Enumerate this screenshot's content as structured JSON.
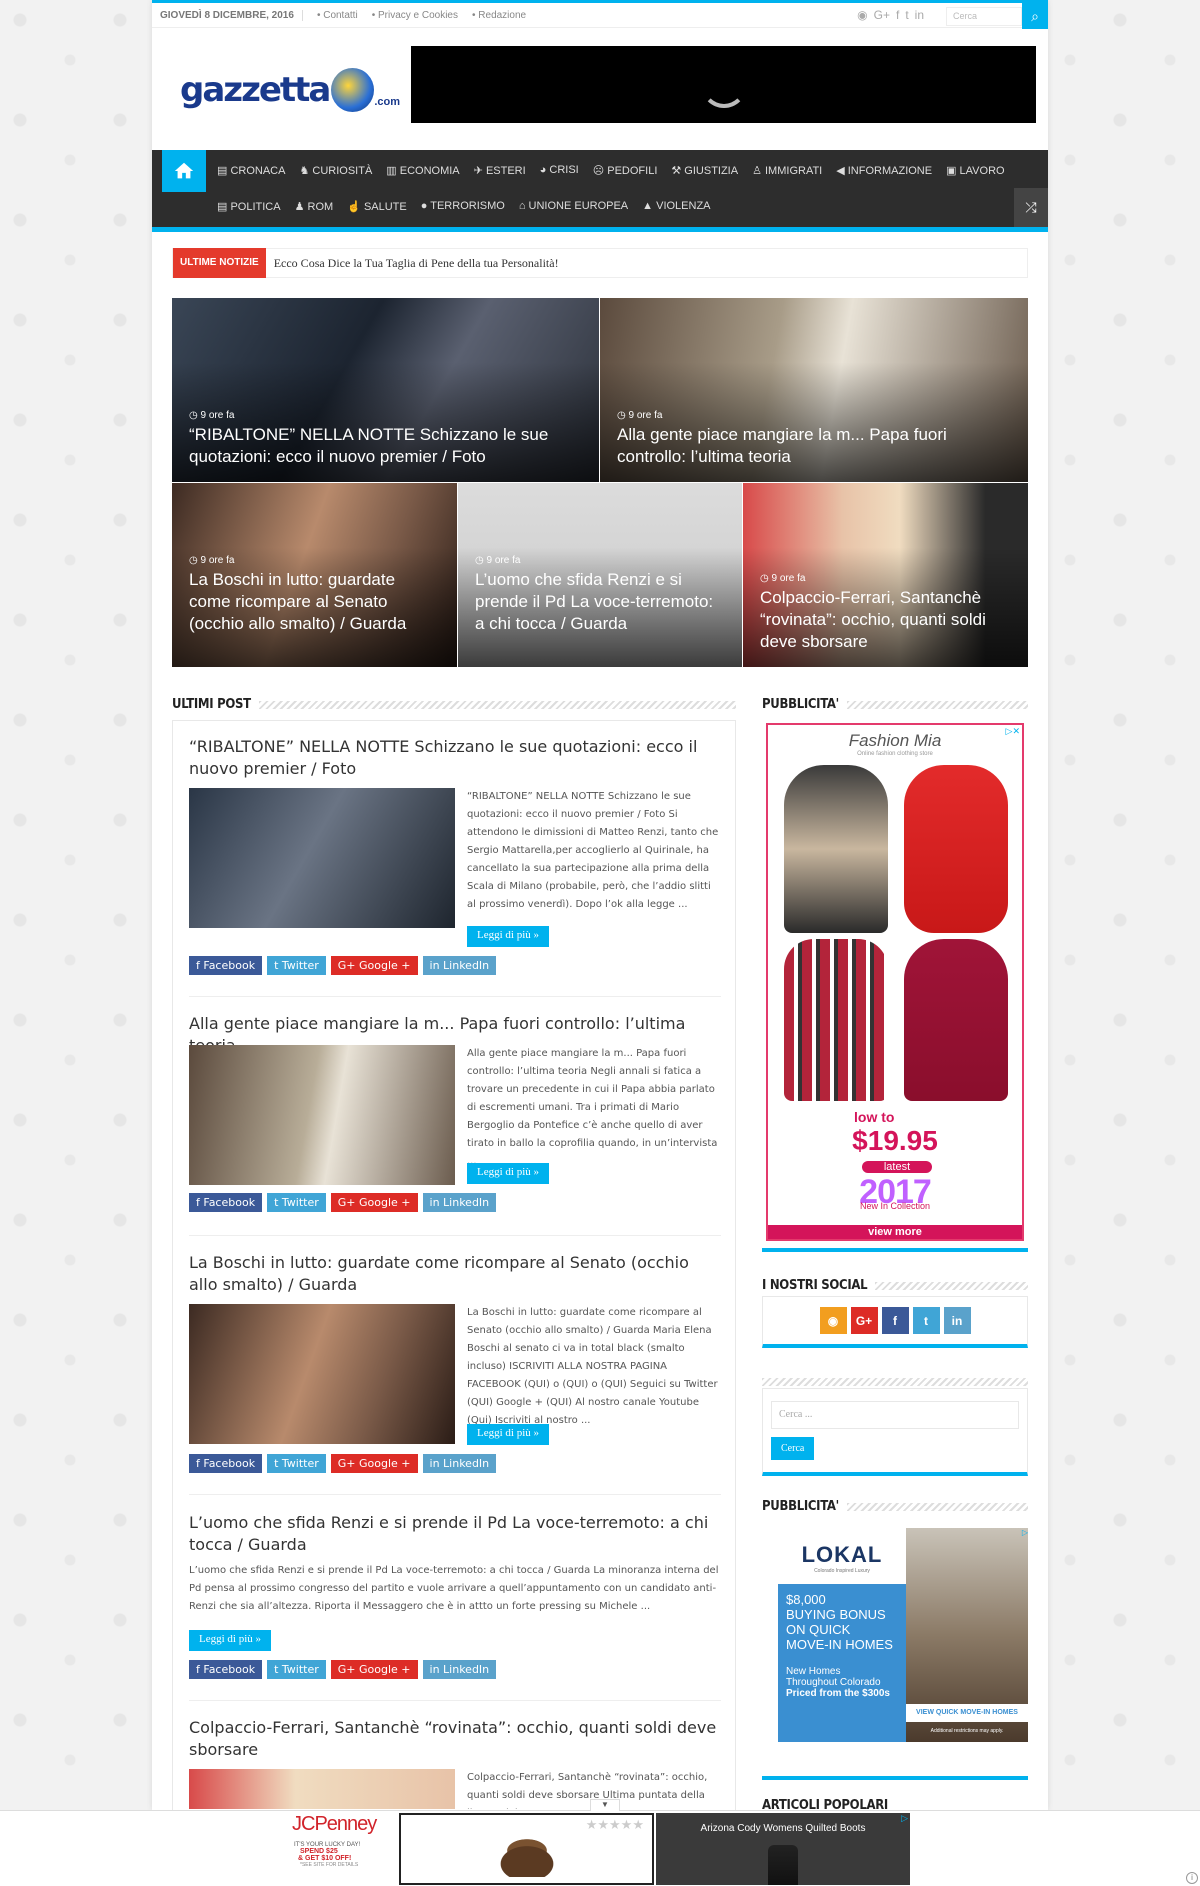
{
  "topbar": {
    "date": "GIOVEDÌ 8 DICEMBRE, 2016",
    "links": [
      "• Contatti",
      "• Privacy e Cookies",
      "• Redazione"
    ],
    "search_placeholder": "Cerca"
  },
  "logo": {
    "text": "gazzetta",
    ".com": ".com",
    "suffix": ".com"
  },
  "nav": {
    "row1": [
      "CRONACA",
      "CURIOSITÀ",
      "ECONOMIA",
      "ESTERI",
      "CRISI",
      "PEDOFILI",
      "GIUSTIZIA",
      "IMMIGRATI",
      "INFORMAZIONE",
      "LAVORO"
    ],
    "row2": [
      "POLITICA",
      "ROM",
      "SALUTE",
      "TERRORISMO",
      "UNIONE EUROPEA",
      "VIOLENZA"
    ]
  },
  "ticker": {
    "label": "ULTIME NOTIZIE",
    "text": "Ecco Cosa Dice la Tua Taglia di Pene della tua Personalità!"
  },
  "slides": [
    {
      "time": "9 ore fa",
      "title": "“RIBALTONE” NELLA NOTTE Schizzano le sue quotazioni: ecco il nuovo premier / Foto"
    },
    {
      "time": "9 ore fa",
      "title": "Alla gente piace mangiare la m... Papa fuori controllo: l’ultima teoria"
    },
    {
      "time": "9 ore fa",
      "title": "La Boschi in lutto: guardate come ricompare al Senato (occhio allo smalto) / Guarda"
    },
    {
      "time": "9 ore fa",
      "title": "L’uomo che sfida Renzi e si prende il Pd La voce-terremoto: a chi tocca / Guarda"
    },
    {
      "time": "9 ore fa",
      "title": "Colpaccio-Ferrari, Santanchè “rovinata”: occhio, quanti soldi deve sborsare"
    }
  ],
  "main": {
    "heading": "ULTIMI POST",
    "more": "Leggi di più »",
    "share": {
      "fb": "Facebook",
      "tw": "Twitter",
      "gp": "Google +",
      "li": "LinkedIn"
    },
    "posts": [
      {
        "title": "“RIBALTONE” NELLA NOTTE Schizzano le sue quotazioni: ecco il nuovo premier / Foto",
        "excerpt": "“RIBALTONE” NELLA NOTTE Schizzano le sue quotazioni: ecco il nuovo premier / Foto Si attendono le dimissioni di Matteo Renzi, tanto che Sergio Mattarella,per accoglierlo al Quirinale, ha cancellato la sua partecipazione alla prima della Scala di Milano (probabile, però, che l’addio slitti al prossimo venerdì). Dopo l’ok alla legge ..."
      },
      {
        "title": "Alla gente piace mangiare la m... Papa fuori controllo: l’ultima teoria",
        "excerpt": "Alla gente piace mangiare la m... Papa fuori controllo: l’ultima teoria   Negli annali si fatica a trovare un precedente in cui il Papa abbia parlato di escrementi umani. Tra i primati di Mario Bergoglio da Pontefice c’è anche quello di aver tirato in ballo la coprofilia quando, in un’intervista ..."
      },
      {
        "title": "La Boschi in lutto: guardate come ricompare al Senato (occhio allo smalto) / Guarda",
        "excerpt": "La Boschi in lutto: guardate come ricompare al Senato (occhio allo smalto) / Guarda Maria Elena Boschi al senato ci va in total black (smalto incluso)     ISCRIVITI ALLA NOSTRA PAGINA FACEBOOK (QUI) o (QUI) o (QUI) Seguici su Twitter (QUI) Google + (QUI) Al nostro canale Youtube (Qui) Iscriviti al nostro ..."
      },
      {
        "title": "L’uomo che sfida Renzi e si prende il Pd La voce-terremoto: a chi tocca / Guarda",
        "excerpt": "L’uomo che sfida Renzi e si prende il Pd La voce-terremoto: a chi tocca / Guarda La minoranza interna del Pd pensa al prossimo congresso del partito e vuole arrivare a quell’appuntamento con un candidato anti-Renzi che sia all’altezza. Riporta il Messaggero che è in attto un forte pressing su Michele ..."
      },
      {
        "title": "Colpaccio-Ferrari, Santanchè “rovinata”: occhio, quanti soldi deve sborsare",
        "excerpt": "Colpaccio-Ferrari, Santanchè “rovinata”: occhio, quanti soldi deve sborsare   Ultima puntata della lite Daniela"
      }
    ]
  },
  "sidebar": {
    "ad_heading": "PUBBLICITA'",
    "social_heading": "I NOSTRI SOCIAL",
    "search_placeholder": "Cerca ...",
    "search_button": "Cerca",
    "ad2_heading": "PUBBLICITA'",
    "popular_heading": "ARTICOLI POPOLARI",
    "fashion_ad": {
      "brand": "Fashion Mia",
      "tagline": "Online fashion clothing store",
      "low": "low to",
      "price": "$19.95",
      "latest": "latest",
      "year": "2017",
      "collection": "New In Collection",
      "cta": "view more"
    },
    "lokal_ad": {
      "brand": "LOKAL",
      "sub": "Colorado Inspired Luxury",
      "line1": "$8,000",
      "line2": "BUYING BONUS",
      "line3": "ON QUICK",
      "line4": "MOVE-IN HOMES",
      "line5": "New Homes",
      "line6": "Throughout Colorado",
      "line7": "Priced from the $300s",
      "cta": "VIEW QUICK MOVE-IN HOMES",
      "note": "Additional restrictions may apply."
    }
  },
  "bottom_ad": {
    "brand": "JCPenney",
    "line1": "IT'S YOUR LUCKY DAY!",
    "line2": "SPEND $25",
    "line3": "& GET $10 OFF!",
    "line4": "*SEE SITE FOR DETAILS",
    "product": "Arizona Cody Womens Quilted Boots",
    "stars": "★★★★★"
  },
  "colors": {
    "accent": "#00b2ee",
    "ticker": "#e43a2c",
    "nav": "#2d2d2d"
  }
}
